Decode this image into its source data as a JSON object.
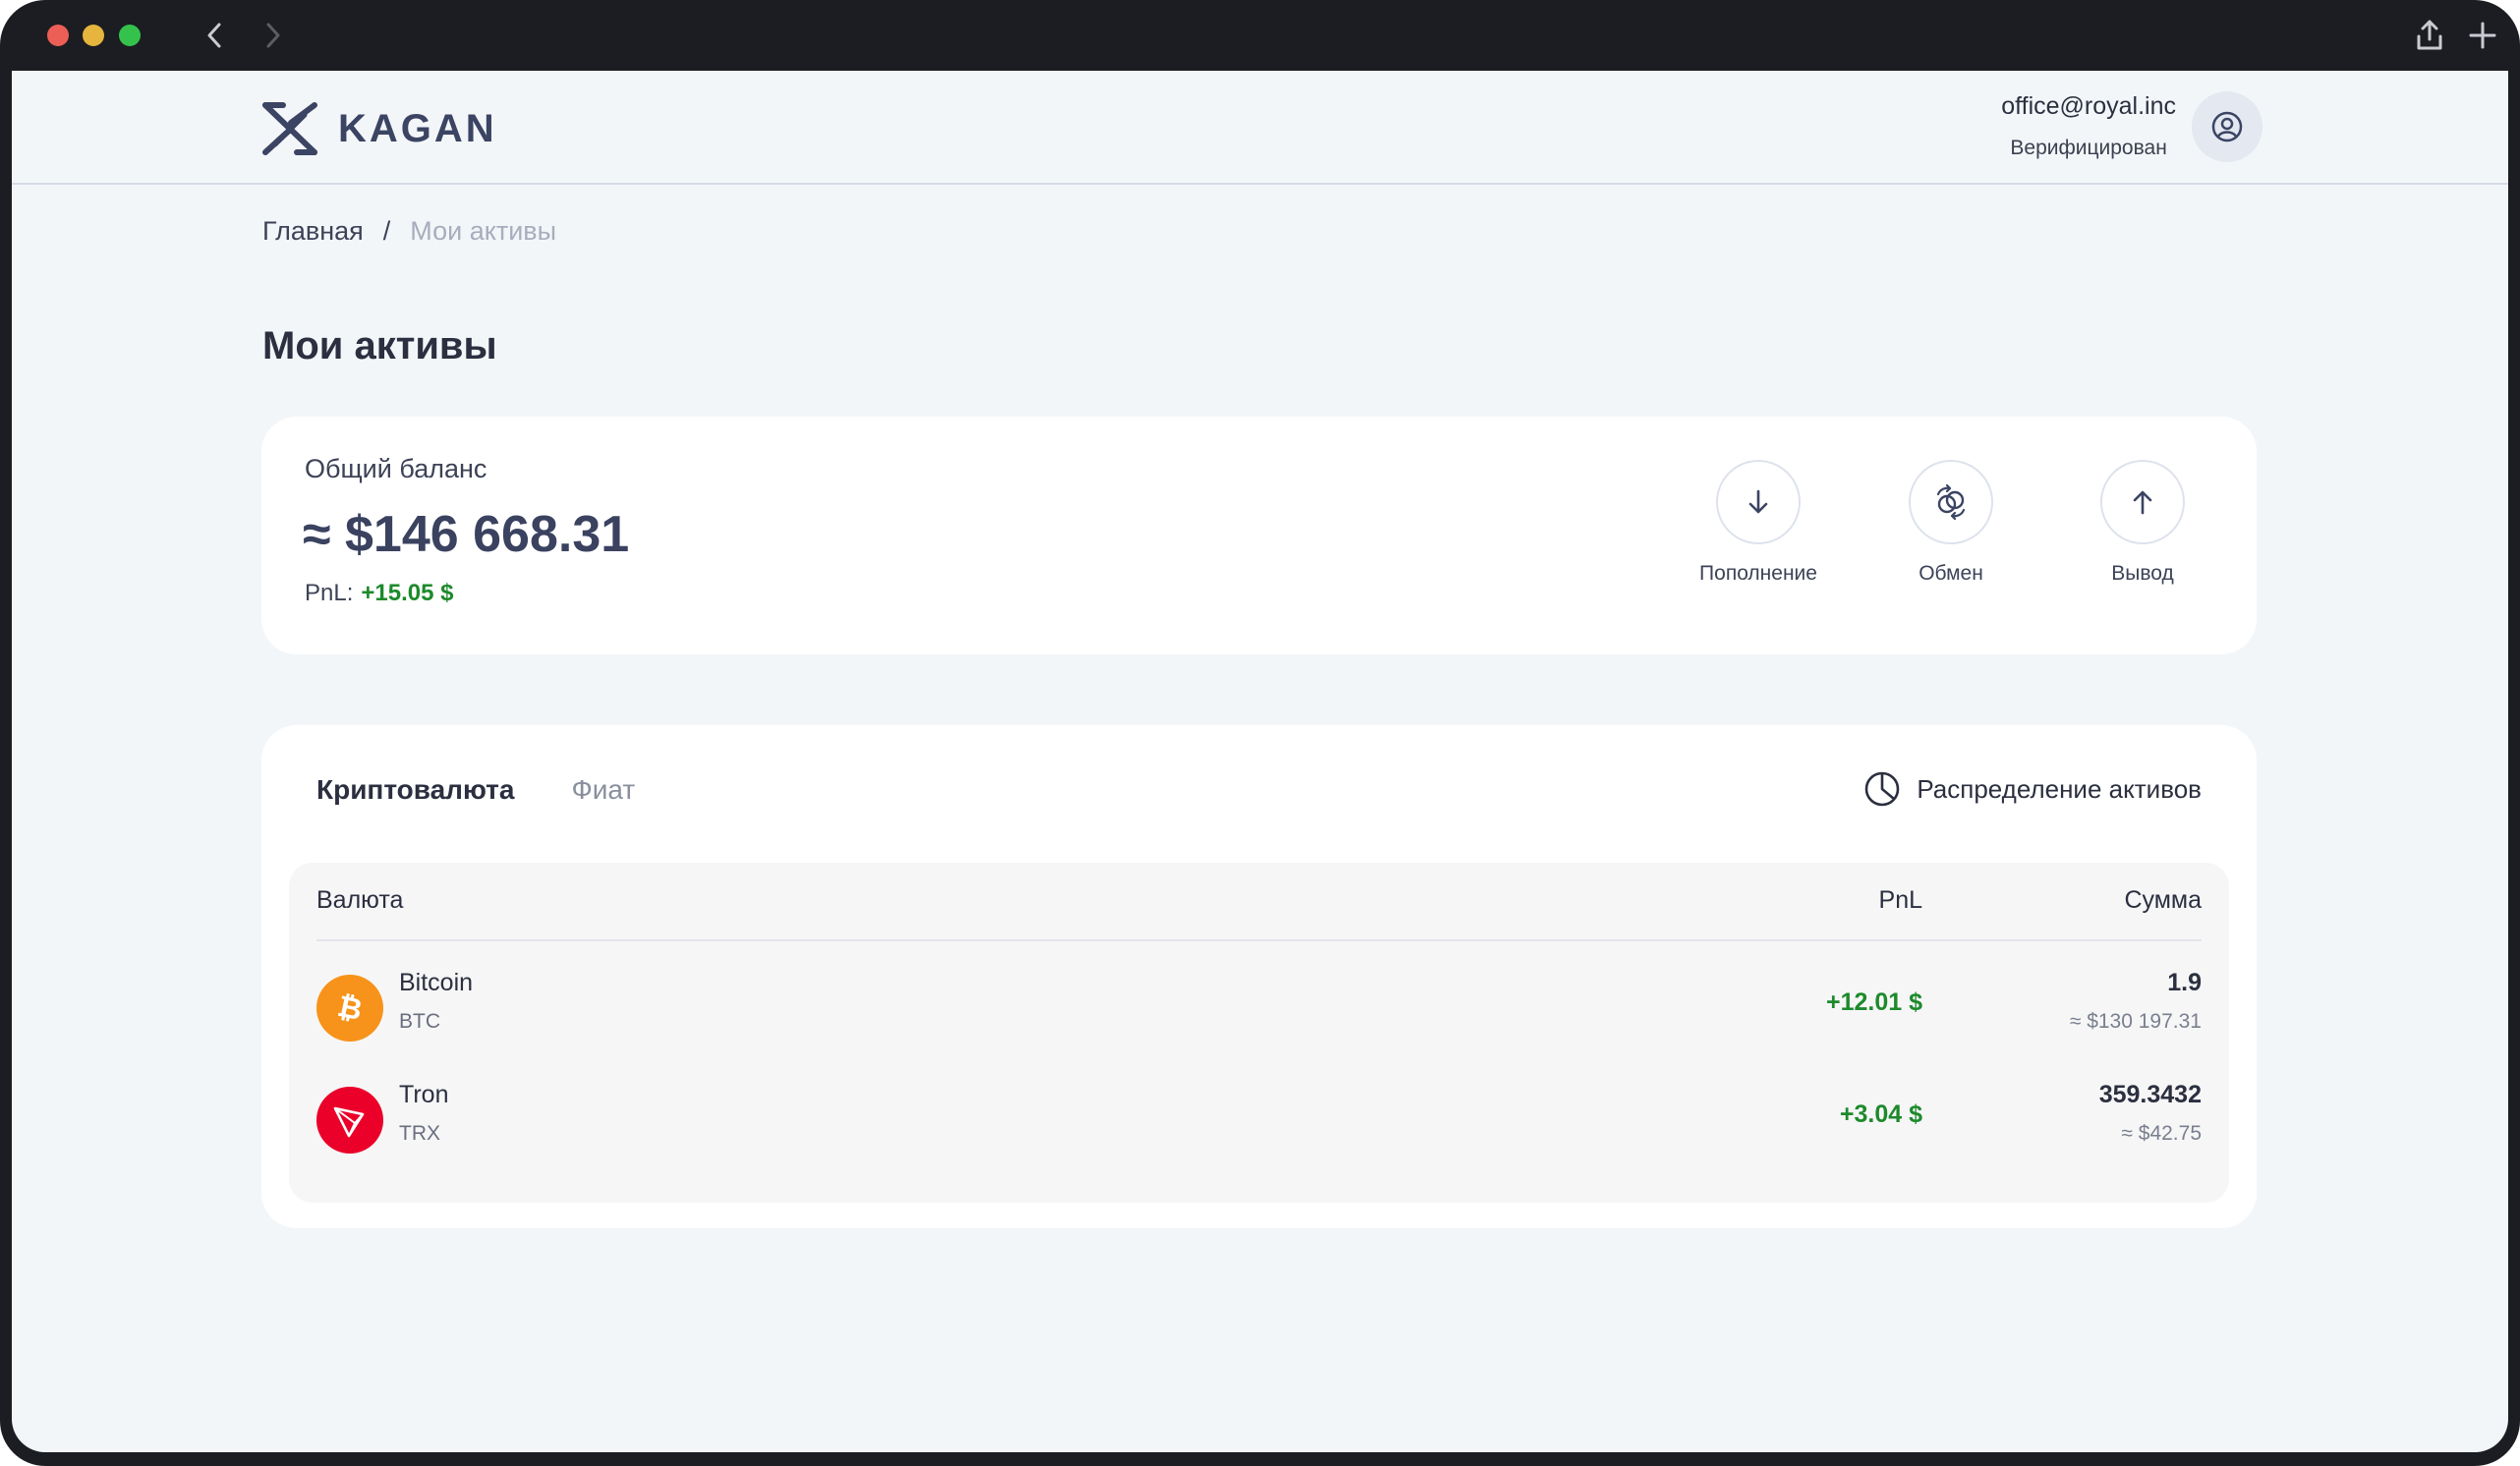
{
  "window": {
    "share_icon": "share-icon",
    "new_tab_icon": "plus-icon"
  },
  "header": {
    "logo_text": "KAGAN",
    "user_email": "office@royal.inc",
    "user_status": "Верифицирован"
  },
  "breadcrumb": {
    "home": "Главная",
    "separator": "/",
    "current": "Мои активы"
  },
  "page_title": "Мои активы",
  "balance": {
    "label": "Общий баланс",
    "value": "≈ $146 668.31",
    "pnl_label": "PnL:",
    "pnl_value": "+15.05 $"
  },
  "actions": [
    {
      "label": "Пополнение",
      "icon": "arrow-down-icon"
    },
    {
      "label": "Обмен",
      "icon": "exchange-icon"
    },
    {
      "label": "Вывод",
      "icon": "arrow-up-icon"
    }
  ],
  "assets": {
    "tabs": [
      {
        "label": "Криптовалюта",
        "active": true
      },
      {
        "label": "Фиат",
        "active": false
      }
    ],
    "distribution_label": "Распределение активов",
    "columns": {
      "currency": "Валюта",
      "pnl": "PnL",
      "sum": "Сумма"
    },
    "rows": [
      {
        "name": "Bitcoin",
        "symbol": "BTC",
        "pnl": "+12.01 $",
        "amount": "1.9",
        "usd": "≈ $130 197.31",
        "icon": "bitcoin-icon",
        "color": "#f7931a"
      },
      {
        "name": "Tron",
        "symbol": "TRX",
        "pnl": "+3.04 $",
        "amount": "359.3432",
        "usd": "≈ $42.75",
        "icon": "tron-icon",
        "color": "#eb0029"
      }
    ]
  },
  "colors": {
    "accent": "#3b4463",
    "positive": "#1d8a2b",
    "background": "#f3f6f9"
  }
}
